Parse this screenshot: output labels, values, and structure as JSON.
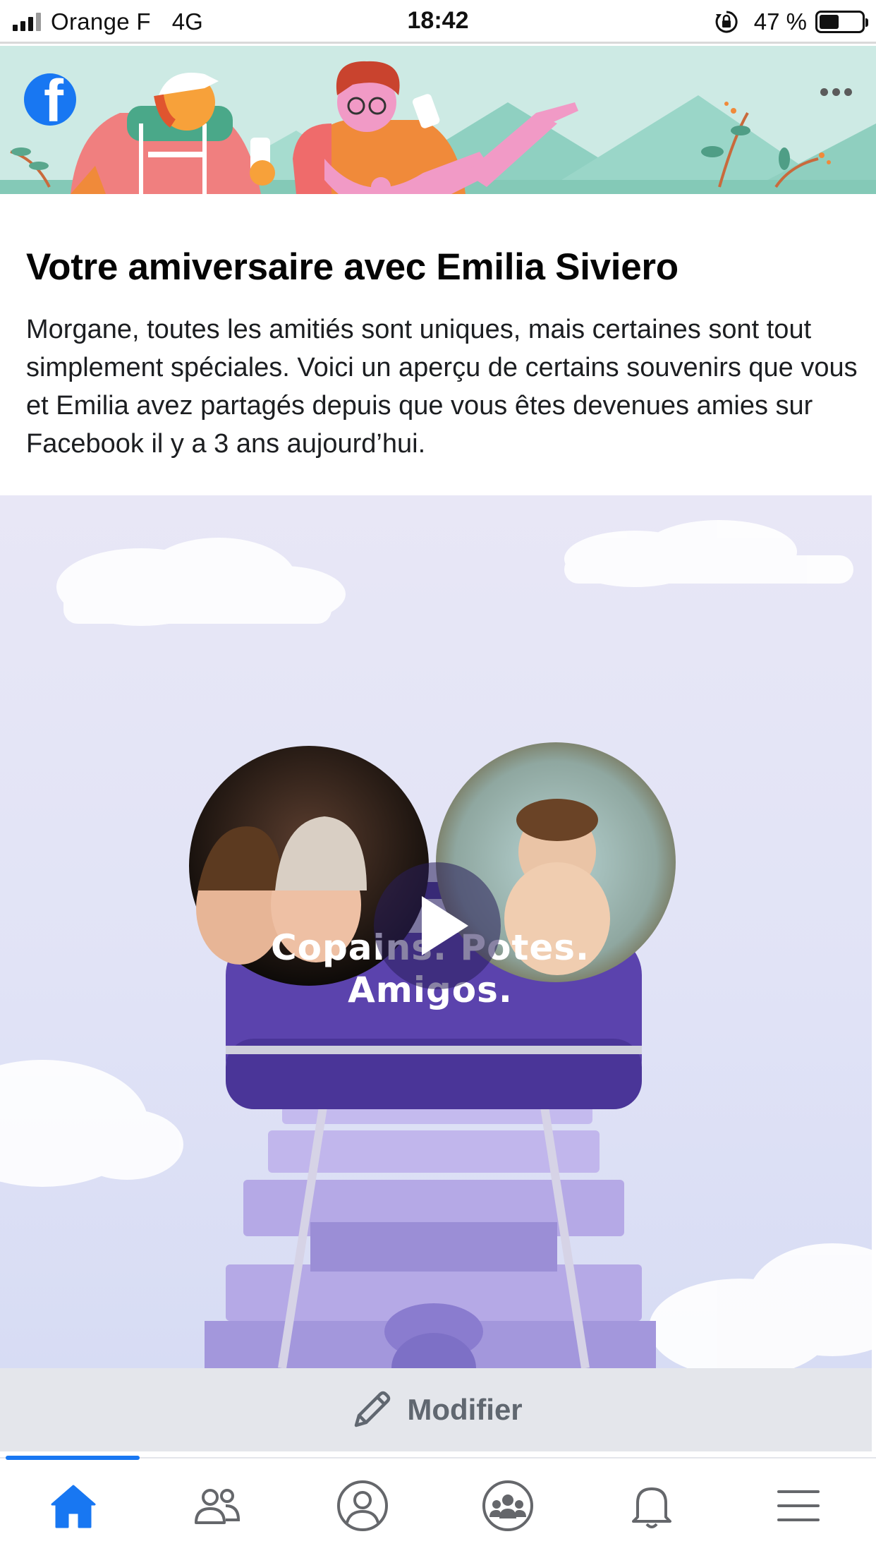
{
  "status_bar": {
    "carrier": "Orange F",
    "network": "4G",
    "time": "18:42",
    "battery_percent": "47 %",
    "battery_level": 0.47
  },
  "banner": {
    "logo_icon": "facebook-logo-icon",
    "more_icon": "more-options-icon",
    "colors": {
      "background": "#cdeae4",
      "brand": "#1877f2"
    }
  },
  "memory": {
    "title": "Votre amiversaire avec Emilia Siviero",
    "description": "Morgane, toutes les amitiés sont uniques, mais certaines sont tout simplement spéciales. Voici un aperçu de certains souvenirs que vous et Emilia avez partagés depuis que vous êtes devenues amies sur Facebook il y a 3 ans aujourd’hui."
  },
  "video": {
    "caption_line1": "Copains. Potes.",
    "caption_line2": "Amigos.",
    "play_icon": "play-icon"
  },
  "edit": {
    "label": "Modifier",
    "icon": "pencil-icon"
  },
  "tabbar": {
    "active": "home",
    "tabs": [
      {
        "id": "home",
        "icon": "home-icon"
      },
      {
        "id": "friends",
        "icon": "friends-icon"
      },
      {
        "id": "profile",
        "icon": "profile-icon"
      },
      {
        "id": "groups",
        "icon": "groups-icon"
      },
      {
        "id": "notifications",
        "icon": "bell-icon"
      },
      {
        "id": "menu",
        "icon": "menu-icon"
      }
    ],
    "colors": {
      "active": "#1877f2",
      "inactive": "#65676b"
    }
  }
}
